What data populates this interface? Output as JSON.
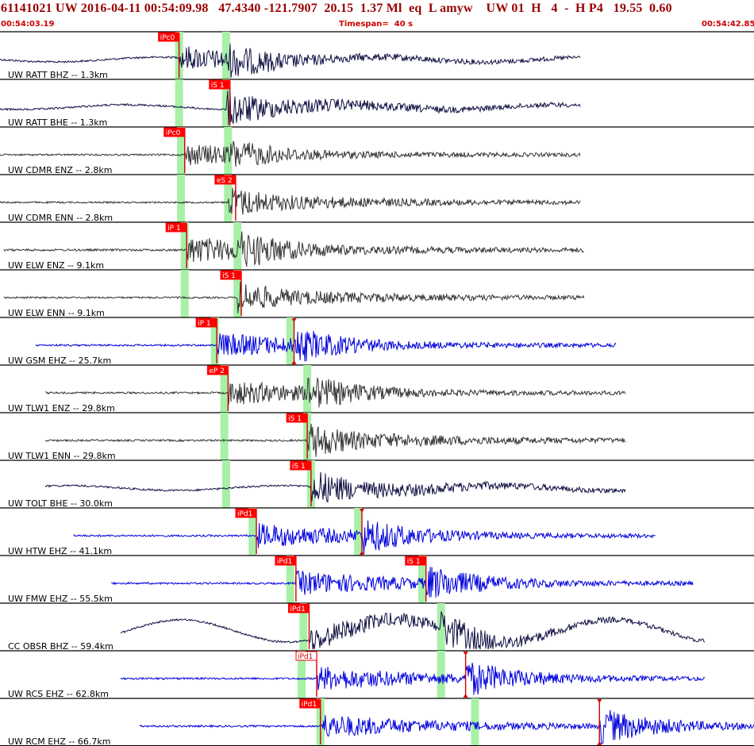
{
  "header": {
    "title": "61141021 UW 2016-04-11 00:54:09.98   47.4340 -121.7907  20.15  1.37 Ml  eq  L amyw    UW 01  H   4  -  H P4   19.55  0.60",
    "start_time": "00:54:03.19",
    "timespan": "Timespan=  40 s",
    "end_time": "00:54:42.85"
  },
  "chart_data": {
    "type": "line",
    "x_unit": "s",
    "xlim": [
      0,
      40
    ],
    "colors": {
      "short_period": "#0000dd",
      "broadband": "#333333",
      "pick_box": "#ff0000",
      "pick_line": "#cc0000",
      "predicted_window": "#a8f0a8"
    },
    "channels": [
      {
        "label": "UW RATT BHZ -- 1.3km",
        "color": "#111144",
        "data_start": 0.0,
        "data_end": 30.8,
        "amp": 1.0,
        "picks": [
          {
            "label": "iPc0",
            "t": 9.5
          }
        ],
        "windows": [
          9.5,
          12.0
        ]
      },
      {
        "label": "UW RATT BHE -- 1.3km",
        "color": "#111144",
        "data_start": 0.0,
        "data_end": 30.8,
        "amp": 1.0,
        "picks": [
          {
            "label": "iS 1",
            "t": 12.2
          }
        ],
        "windows": [
          9.5,
          12.0
        ]
      },
      {
        "label": "UW CDMR ENZ -- 2.8km",
        "color": "#333333",
        "data_start": 0.0,
        "data_end": 30.8,
        "amp": 0.9,
        "picks": [
          {
            "label": "iPc0",
            "t": 9.8
          }
        ],
        "windows": [
          9.6,
          12.1
        ]
      },
      {
        "label": "UW CDMR ENN -- 2.8km",
        "color": "#333333",
        "data_start": 0.0,
        "data_end": 30.8,
        "amp": 0.9,
        "picks": [
          {
            "label": "eS 2",
            "t": 12.5
          }
        ],
        "windows": [
          9.6,
          12.1
        ]
      },
      {
        "label": "UW ELW ENZ -- 9.1km",
        "color": "#333333",
        "data_start": 0.2,
        "data_end": 31.0,
        "amp": 1.1,
        "picks": [
          {
            "label": "iP 1",
            "t": 9.9
          }
        ],
        "windows": [
          9.8,
          12.6
        ]
      },
      {
        "label": "UW ELW ENN -- 9.1km",
        "color": "#333333",
        "data_start": 0.2,
        "data_end": 31.0,
        "amp": 0.9,
        "picks": [
          {
            "label": "iS 1",
            "t": 12.8
          }
        ],
        "windows": [
          9.8,
          12.6
        ]
      },
      {
        "label": "UW GSM EHZ -- 25.7km",
        "color": "#0000dd",
        "data_start": 1.9,
        "data_end": 32.7,
        "amp": 1.0,
        "picks": [
          {
            "label": "iP 1",
            "t": 11.5
          },
          {
            "label": "",
            "t": 15.6
          }
        ],
        "windows": [
          11.4,
          15.4
        ]
      },
      {
        "label": "UW TLW1 ENZ -- 29.8km",
        "color": "#333333",
        "data_start": 2.4,
        "data_end": 33.2,
        "amp": 1.0,
        "picks": [
          {
            "label": "eP 2",
            "t": 12.1
          }
        ],
        "windows": [
          11.9,
          16.3
        ]
      },
      {
        "label": "UW TLW1 ENN -- 29.8km",
        "color": "#333333",
        "data_start": 2.4,
        "data_end": 33.2,
        "amp": 1.0,
        "picks": [
          {
            "label": "iS 1",
            "t": 16.3
          }
        ],
        "windows": [
          11.9,
          16.3
        ]
      },
      {
        "label": "UW TOLT BHE -- 30.0km",
        "color": "#111144",
        "data_start": 2.4,
        "data_end": 33.2,
        "amp": 1.0,
        "picks": [
          {
            "label": "iS 1",
            "t": 16.5
          }
        ],
        "windows": [
          12.0,
          16.5
        ]
      },
      {
        "label": "UW HTW EHZ -- 41.1km",
        "color": "#0000dd",
        "data_start": 3.9,
        "data_end": 34.8,
        "amp": 1.0,
        "picks": [
          {
            "label": "iPd1",
            "t": 13.6
          },
          {
            "label": "",
            "t": 19.2
          }
        ],
        "windows": [
          13.4,
          19.0
        ]
      },
      {
        "label": "UW FMW EHZ -- 55.5km",
        "color": "#0000dd",
        "data_start": 5.9,
        "data_end": 36.8,
        "amp": 1.0,
        "picks": [
          {
            "label": "iPd1",
            "t": 15.7
          },
          {
            "label": "iS 1",
            "t": 22.6
          }
        ],
        "windows": [
          15.4,
          22.4
        ]
      },
      {
        "label": "CC OBSR BHZ -- 59.4km",
        "color": "#111144",
        "data_start": 6.4,
        "data_end": 37.4,
        "amp": 1.0,
        "picks": [
          {
            "label": "iPd1",
            "t": 16.4
          }
        ],
        "windows": [
          16.1,
          23.4
        ]
      },
      {
        "label": "UW RCS EHZ -- 62.8km",
        "color": "#0000dd",
        "data_start": 6.4,
        "data_end": 37.4,
        "amp": 1.0,
        "picks": [
          {
            "label": "iPd1",
            "t": 16.8,
            "selected": true
          },
          {
            "label": "",
            "t": 24.7
          }
        ],
        "windows": [
          16.0,
          23.4
        ]
      },
      {
        "label": "UW RCM EHZ -- 66.7km",
        "color": "#0000dd",
        "data_start": 7.4,
        "data_end": 40.0,
        "amp": 1.0,
        "picks": [
          {
            "label": "iPd1",
            "t": 17.0
          },
          {
            "label": "",
            "t": 31.8
          }
        ],
        "windows": [
          17.0,
          25.2
        ]
      }
    ]
  }
}
